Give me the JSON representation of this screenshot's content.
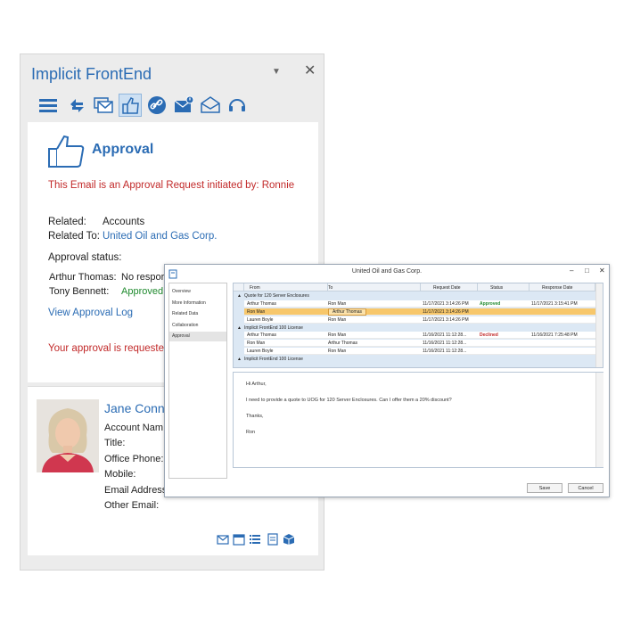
{
  "pane": {
    "title": "Implicit FrontEnd",
    "collapse_glyph": "▼",
    "close_glyph": "✕",
    "toolbar": [
      "menu-icon",
      "sync-icon",
      "emails-icon",
      "thumbs-up-icon",
      "link-icon",
      "mail-alert-icon",
      "mail-open-icon",
      "headset-icon"
    ]
  },
  "approval": {
    "heading": "Approval",
    "request_text": "This Email is an Approval Request initiated by: Ronnie",
    "related_label": "Related:",
    "related_value": "Accounts",
    "related_to_label": "Related To:",
    "related_to_value": "United Oil and Gas Corp.",
    "status_heading": "Approval status:",
    "people": [
      {
        "name": "Arthur Thomas:",
        "status": "No respor"
      },
      {
        "name": "Tony Bennett:",
        "status": "Approved"
      }
    ],
    "view_log": "View Approval Log",
    "requested_text": "Your approval is requested"
  },
  "contact": {
    "name": "Jane Conn",
    "fields": [
      "Account Nam",
      "Title:",
      "Office Phone:",
      "Mobile:",
      "Email Address",
      "Other Email:"
    ]
  },
  "dialog": {
    "title": "United Oil and Gas Corp.",
    "controls": {
      "minimize": "–",
      "maximize": "□",
      "close": "✕"
    },
    "nav": [
      "Overview",
      "More Information",
      "Related Data",
      "Collaboration",
      "Approval"
    ],
    "nav_selected": 4,
    "columns": [
      "From",
      "To",
      "Request Date",
      "Status",
      "Response Date"
    ],
    "groups": [
      {
        "label": "Quote for 120 Server Enclosures",
        "rows": [
          {
            "from": "Arthur Thomas",
            "to": "Ron Man",
            "request": "11/17/2021 3:14:26 PM",
            "status": "Approved",
            "response": "11/17/2021 3:15:41 PM",
            "selected": false
          },
          {
            "from": "Ron Man",
            "to": "Arthur Thomas",
            "request": "11/17/2021 3:14:26 PM",
            "status": "",
            "response": "",
            "selected": true
          },
          {
            "from": "Lauren Boyle",
            "to": "Ron Man",
            "request": "11/17/2021 3:14:26 PM",
            "status": "",
            "response": "",
            "selected": false
          }
        ]
      },
      {
        "label": "Implicit FrontEnd 100 License",
        "rows": [
          {
            "from": "Arthur Thomas",
            "to": "Ron Man",
            "request": "11/16/2021 11:12:28...",
            "status": "Declined",
            "response": "11/16/2021 7:25:48 PM",
            "selected": false
          },
          {
            "from": "Ron Man",
            "to": "Arthur Thomas",
            "request": "11/16/2021 11:12:28...",
            "status": "",
            "response": "",
            "selected": false
          },
          {
            "from": "Lauren Boyle",
            "to": "Ron Man",
            "request": "11/16/2021 11:12:28...",
            "status": "",
            "response": "",
            "selected": false
          }
        ]
      },
      {
        "label": "Implicit FrontEnd 100 License",
        "rows": []
      }
    ],
    "message": [
      "Hi Arthur,",
      "I need to provide a quote to UOG for 120 Server Enclosures. Can I offer them a 20% discount?",
      "Thanks,",
      "Ron"
    ],
    "save_label": "Save",
    "cancel_label": "Cancel"
  },
  "colors": {
    "accent": "#2b6cb4",
    "alert": "#c22a2a",
    "approved": "#1f8a2e",
    "selected_row": "#f7c76b"
  }
}
